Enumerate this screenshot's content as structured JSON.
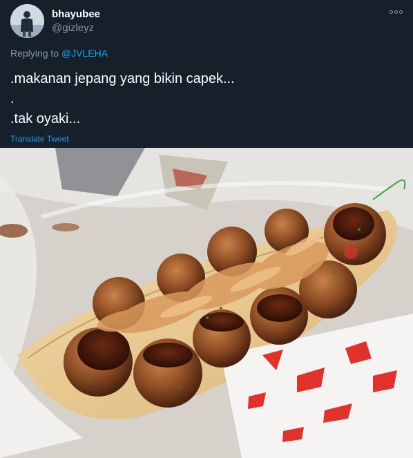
{
  "tweet": {
    "display_name": "bhayubee",
    "handle": "@gizleyz",
    "replying_prefix": "Replying to",
    "replying_to": "@JVLEHA",
    "lines": [
      ".makanan jepang yang bikin capek...",
      ".",
      ".tak oyaki..."
    ],
    "translate_label": "Translate Tweet"
  },
  "icons": {
    "more": "more-options-icon",
    "avatar": "user-avatar"
  },
  "colors": {
    "background": "#15202b",
    "text_primary": "#ffffff",
    "text_secondary": "#8899a6",
    "accent": "#1da1f2"
  }
}
